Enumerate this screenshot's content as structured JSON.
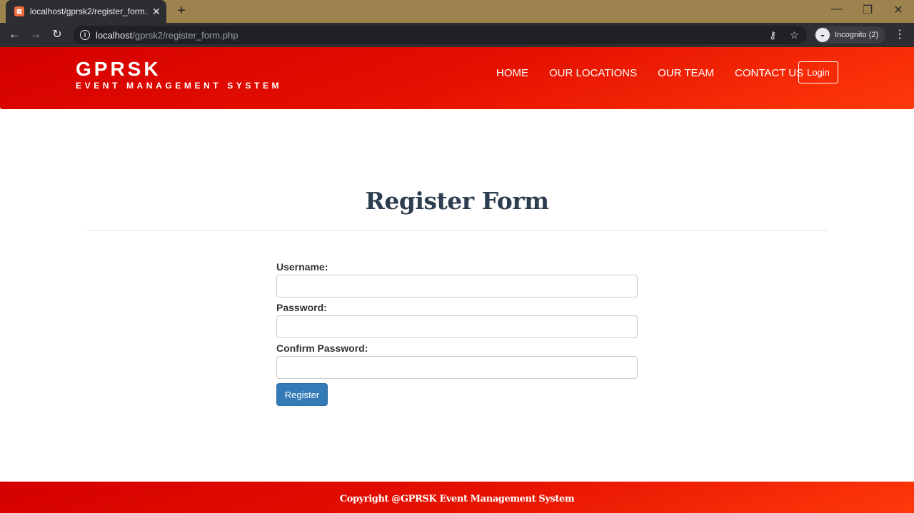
{
  "browser": {
    "tab_title": "localhost/gprsk2/register_form.php",
    "tab_close": "✕",
    "new_tab": "+",
    "url_host": "localhost",
    "url_path": "/gprsk2/register_form.php",
    "incognito_label": "Incognito (2)",
    "icons": [
      "back-icon",
      "forward-icon",
      "reload-icon",
      "info-icon",
      "key-icon",
      "star-icon",
      "incognito-icon",
      "menu-icon",
      "minimize-icon",
      "restore-icon",
      "close-icon"
    ]
  },
  "header": {
    "brand_name": "GPRSK",
    "brand_tagline": "EVENT MANAGEMENT SYSTEM",
    "nav": [
      {
        "label": "HOME"
      },
      {
        "label": "OUR LOCATIONS"
      },
      {
        "label": "OUR TEAM"
      },
      {
        "label": "CONTACT US"
      }
    ],
    "login_label": "Login"
  },
  "main": {
    "title": "Register Form",
    "fields": [
      {
        "label": "Username:",
        "value": "",
        "placeholder": ""
      },
      {
        "label": "Password:",
        "value": "",
        "placeholder": ""
      },
      {
        "label": "Confirm Password:",
        "value": "",
        "placeholder": ""
      }
    ],
    "submit_label": "Register"
  },
  "footer": {
    "text": "Copyright @GPRSK Event Management System"
  },
  "colors": {
    "header_red": "#e51000",
    "header_orange": "#ff3a0a",
    "title_navy": "#2d3e50",
    "button_blue": "#337ab7",
    "tabstrip_gold": "#9d844f"
  }
}
